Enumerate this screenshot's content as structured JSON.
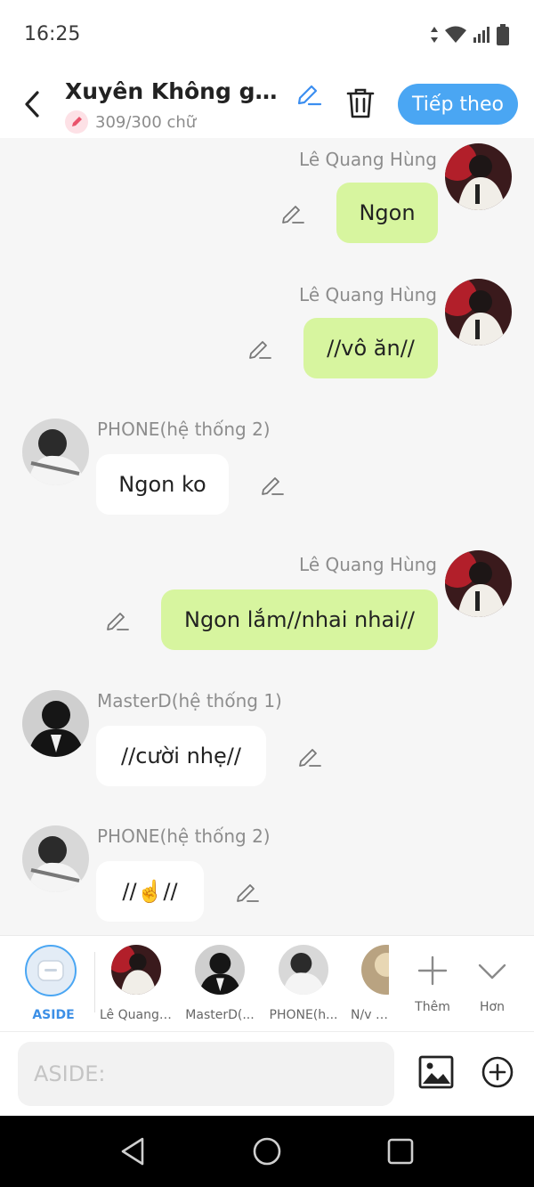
{
  "status": {
    "time": "16:25"
  },
  "header": {
    "title": "Xuyên Không gặp h...",
    "word_count": "309/300 chữ",
    "next_label": "Tiếp theo",
    "accent": "#4aa6f3"
  },
  "messages": [
    {
      "side": "right",
      "name": "Lê Quang Hùng",
      "text": "Ngon"
    },
    {
      "side": "right",
      "name": "Lê Quang Hùng",
      "text": "//vô ăn//"
    },
    {
      "side": "left",
      "name": "PHONE(hệ thống 2)",
      "text": "Ngon ko"
    },
    {
      "side": "right",
      "name": "Lê Quang Hùng",
      "text": "Ngon lắm//nhai nhai//"
    },
    {
      "side": "left",
      "name": "MasterD(hệ thống 1)",
      "text": "//cười nhẹ//"
    },
    {
      "side": "left",
      "name": "PHONE(hệ thống 2)",
      "text": "//☝️//"
    }
  ],
  "cast": {
    "aside": "ASIDE",
    "items": [
      "Lê Quang ...",
      "MasterD(...",
      "PHONE(h...",
      "N/v cả"
    ],
    "add_label": "Thêm",
    "more_label": "Hơn"
  },
  "composer": {
    "placeholder": "ASIDE:"
  },
  "colors": {
    "my_bubble": "#d7f59f",
    "their_bubble": "#ffffff",
    "background": "#f6f6f6"
  }
}
